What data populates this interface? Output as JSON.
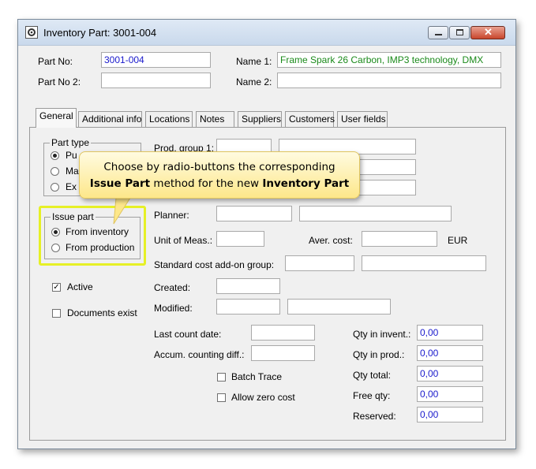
{
  "window": {
    "title": "Inventory Part: 3001-004",
    "icons": {
      "app": "gear-icon",
      "minimize": "minimize-icon",
      "maximize": "maximize-icon",
      "close": "close-icon"
    }
  },
  "header": {
    "part_no_label": "Part No:",
    "part_no_value": "3001-004",
    "part_no2_label": "Part No 2:",
    "part_no2_value": "",
    "name1_label": "Name 1:",
    "name1_value": "Frame Spark 26 Carbon, IMP3 technology, DMX",
    "name2_label": "Name 2:",
    "name2_value": ""
  },
  "tabs": [
    "General",
    "Additional info",
    "Locations",
    "Notes",
    "Suppliers",
    "Customers",
    "User fields"
  ],
  "part_type": {
    "label": "Part type",
    "options": [
      "Pu",
      "Ma",
      "Ex"
    ]
  },
  "issue_part": {
    "label": "Issue part",
    "options": [
      "From inventory",
      "From production"
    ],
    "selected": "From inventory"
  },
  "active_label": "Active",
  "active_checked": true,
  "documents_exist_label": "Documents exist",
  "documents_exist_checked": false,
  "labels": {
    "prod_group": "Prod. group 1:",
    "planner": "Planner:",
    "unit_of_meas": "Unit of Meas.:",
    "aver_cost": "Aver. cost:",
    "currency": "EUR",
    "std_cost_group": "Standard cost add-on group:",
    "created": "Created:",
    "modified": "Modified:",
    "last_count_date": "Last count date:",
    "accum_counting_diff": "Accum. counting diff.:",
    "batch_trace": "Batch Trace",
    "allow_zero_cost": "Allow zero cost"
  },
  "quantities": [
    {
      "label": "Qty in invent.:",
      "value": "0,00"
    },
    {
      "label": "Qty in prod.:",
      "value": "0,00"
    },
    {
      "label": "Qty total:",
      "value": "0,00"
    },
    {
      "label": "Free qty:",
      "value": "0,00"
    },
    {
      "label": "Reserved:",
      "value": "0,00"
    }
  ],
  "callout": {
    "line1": "Choose by radio-buttons the corresponding",
    "bold1": "Issue Part",
    "middle": "method for the new",
    "bold2": "Inventory Part"
  },
  "colors": {
    "highlight": "#e6f026",
    "callout_bg": "#fde78a",
    "value_blue": "#1a1acc",
    "value_green": "#1a8a1a"
  }
}
